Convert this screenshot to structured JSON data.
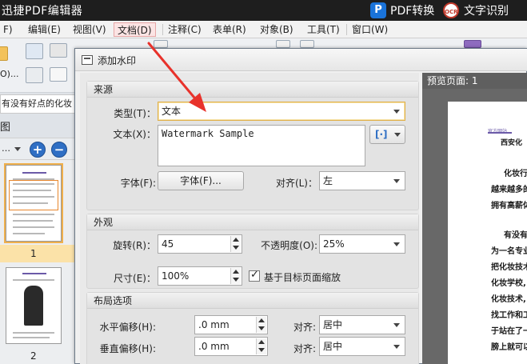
{
  "app": {
    "title": "迅捷PDF编辑器",
    "pdf_convert": "PDF转换",
    "pdf_logo": "P",
    "ocr_logo": "OCR",
    "ocr": "文字识别"
  },
  "menu": [
    {
      "label": "F)",
      "active": false
    },
    {
      "label": "编辑(E)",
      "active": false
    },
    {
      "label": "视图(V)",
      "active": false
    },
    {
      "label": "文档(D)",
      "active": true
    },
    {
      "label": "注释(C)",
      "active": false
    },
    {
      "label": "表单(R)",
      "active": false
    },
    {
      "label": "对象(B)",
      "active": false
    },
    {
      "label": "工具(T)",
      "active": false
    },
    {
      "label": "窗口(W)",
      "active": false
    }
  ],
  "toolbar": {
    "left_label": "O)..."
  },
  "left_panel": {
    "address_text": "有没有好点的化妆",
    "thumbnails_title": "图",
    "view_dropdown": "…",
    "zoom_in": "+",
    "zoom_out": "−",
    "pages": [
      "1",
      "2"
    ]
  },
  "dialog": {
    "title": "添加水印",
    "source": {
      "heading": "来源",
      "type_label": "类型(T)：",
      "type_value": "文本",
      "text_label": "文本(X)：",
      "text_value": "Watermark Sample",
      "insert_icon": "[·]",
      "font_label": "字体(F):",
      "font_button": "字体(F)...",
      "align_label": "对齐(L)：",
      "align_value": "左"
    },
    "appearance": {
      "heading": "外观",
      "rotation_label": "旋转(R)：",
      "rotation_value": "45",
      "opacity_label": "不透明度(O):",
      "opacity_value": "25%",
      "size_label": "尺寸(E)：",
      "size_value": "100%",
      "scale_checkbox_label": "基于目标页面缩放",
      "scale_checked": true
    },
    "layout": {
      "heading": "布局选项",
      "h_offset_label": "水平偏移(H):",
      "h_offset_value": ".0 mm",
      "h_align_label": "对齐:",
      "h_align_value": "居中",
      "v_offset_label": "垂直偏移(H):",
      "v_offset_value": ".0 mm",
      "v_align_label": "对齐:",
      "v_align_value": "居中"
    },
    "preview": {
      "label": "预览页面: 1",
      "header_small": "官方网站",
      "header_line": "西安化",
      "lines": [
        "化妆行",
        "越来越多的",
        "拥有高薪体",
        "有没有",
        "为一名专业",
        "把化妆技术",
        "化妆学校,",
        "化妆技术,",
        "找工作和工",
        "于站在了一",
        "膀上就可以"
      ]
    }
  },
  "colors": {
    "accent_red": "#e8322b",
    "active_menu_bg": "#fbe4e4",
    "title_bar": "#1e1e1e",
    "focus_border": "#e0b04a"
  }
}
